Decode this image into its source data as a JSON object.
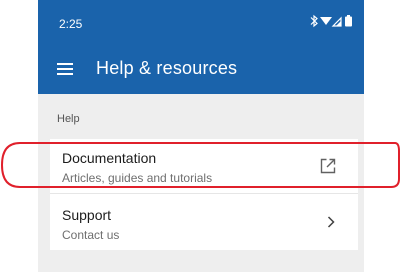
{
  "status_bar": {
    "time": "2:25",
    "icons": [
      "bluetooth-icon",
      "wifi-icon",
      "signal-icon",
      "battery-icon"
    ]
  },
  "app_bar": {
    "menu_icon": "menu-icon",
    "title": "Help & resources"
  },
  "section": {
    "label": "Help"
  },
  "items": [
    {
      "title": "Documentation",
      "subtitle": "Articles, guides and tutorials",
      "icon": "open-external-icon"
    },
    {
      "title": "Support",
      "subtitle": "Contact us",
      "icon": "chevron-right-icon"
    }
  ],
  "colors": {
    "app_bar": "#1a63ab",
    "background": "#eeeeee",
    "card": "#ffffff",
    "annotation": "#e0202b"
  }
}
